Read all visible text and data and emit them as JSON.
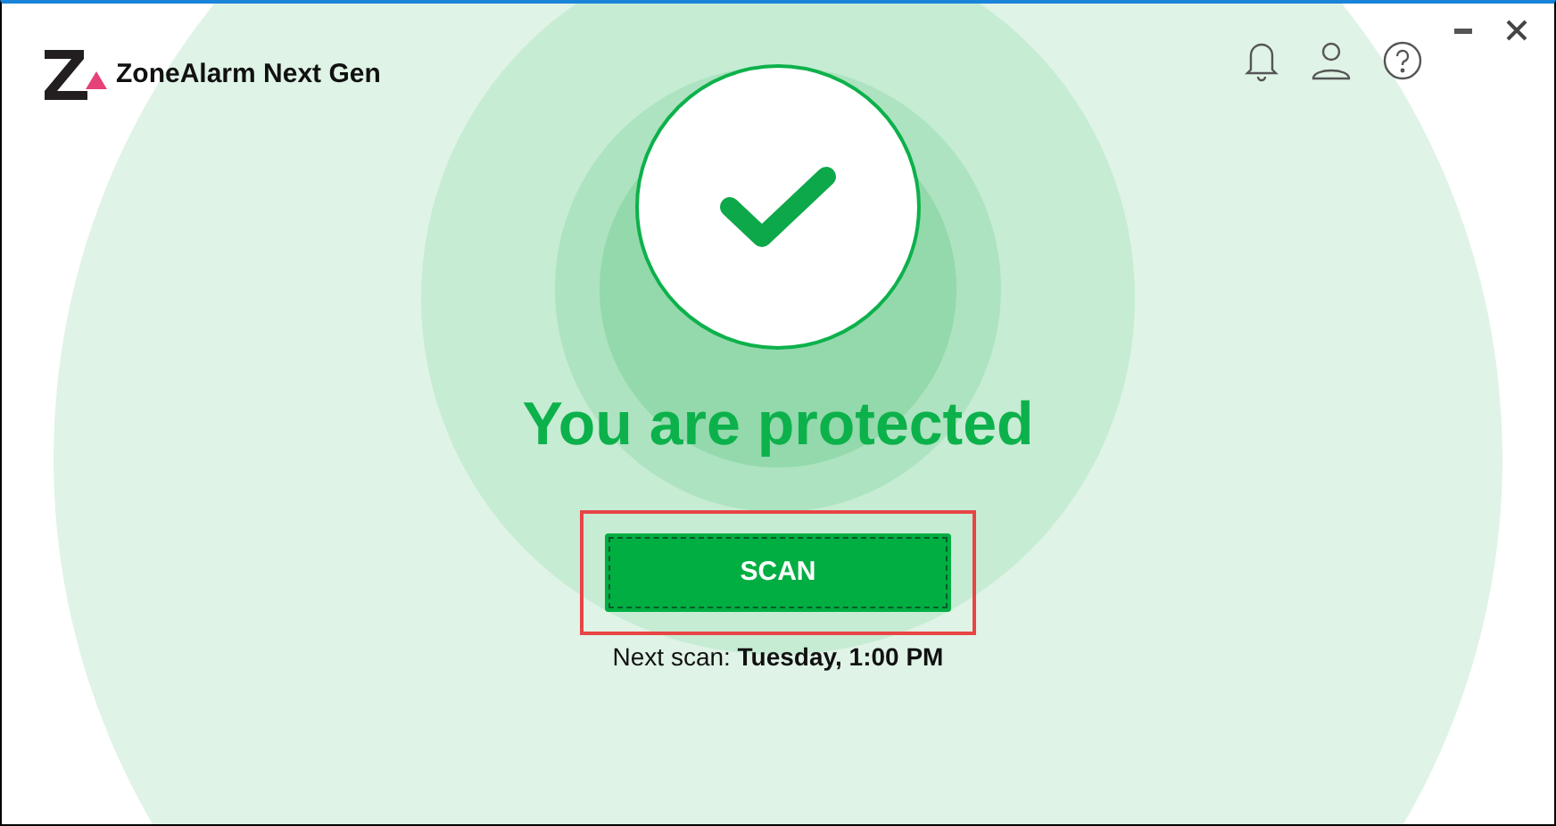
{
  "app": {
    "title": "ZoneAlarm Next Gen"
  },
  "status": {
    "message": "You are protected"
  },
  "scan_button": {
    "label": "SCAN",
    "highlighted": true
  },
  "next_scan": {
    "text": "Next scan: **Tuesday, 1:00 PM**"
  }
}
